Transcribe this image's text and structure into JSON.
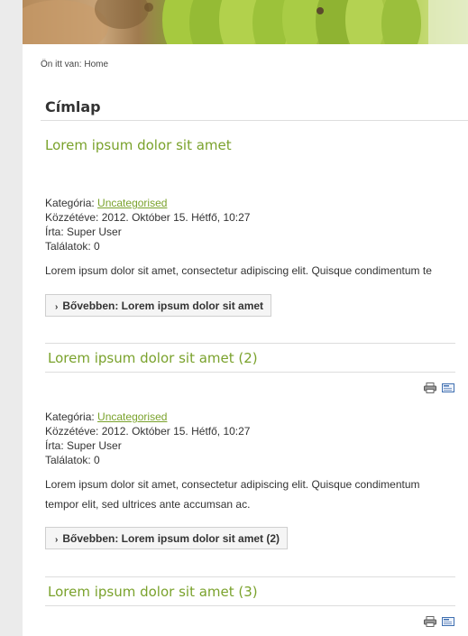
{
  "breadcrumb": {
    "prefix": "Ön itt van:",
    "current": "Home"
  },
  "page": {
    "title": "Címlap"
  },
  "articles": [
    {
      "title": "Lorem ipsum dolor sit amet",
      "category_label": "Kategória:",
      "category": "Uncategorised",
      "published": "Közzétéve: 2012. Október 15. Hétfő, 10:27",
      "author": "Írta: Super User",
      "hits": "Találatok: 0",
      "body_line1": "Lorem ipsum dolor sit amet, consectetur adipiscing elit. Quisque condimentum te",
      "readmore": "Bővebben: Lorem ipsum dolor sit amet"
    },
    {
      "title": "Lorem ipsum dolor sit amet (2)",
      "category_label": "Kategória:",
      "category": "Uncategorised",
      "published": "Közzétéve: 2012. Október 15. Hétfő, 10:27",
      "author": "Írta: Super User",
      "hits": "Találatok: 0",
      "body_line1": "Lorem ipsum dolor sit amet, consectetur adipiscing elit. Quisque condimentum",
      "body_line2": "tempor elit, sed ultrices ante accumsan ac.",
      "readmore": "Bővebben: Lorem ipsum dolor sit amet (2)"
    },
    {
      "title": "Lorem ipsum dolor sit amet (3)"
    }
  ],
  "icons": [
    "print-icon",
    "email-icon"
  ],
  "colors": {
    "accent": "#7aa22c",
    "gutter": "#ebebeb"
  }
}
